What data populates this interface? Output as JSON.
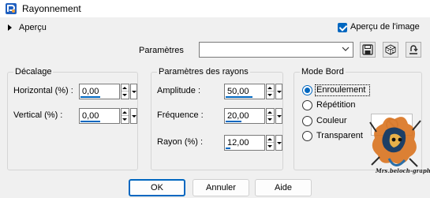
{
  "window": {
    "title": "Rayonnement",
    "app_icon": "psp-logo-icon"
  },
  "preview_toggle": {
    "label": "Aperçu"
  },
  "image_preview": {
    "label": "Aperçu de l'image",
    "checked": true
  },
  "params": {
    "label": "Paramètres",
    "value": ""
  },
  "groups": {
    "decalage": {
      "title": "Décalage",
      "horizontal": {
        "label": "Horizontal (%) :",
        "value": "0,00"
      },
      "vertical": {
        "label": "Vertical (%) :",
        "value": "0,00"
      }
    },
    "rayons": {
      "title": "Paramètres des rayons",
      "amplitude": {
        "label": "Amplitude :",
        "value": "50,00"
      },
      "frequence": {
        "label": "Fréquence :",
        "value": "20,00"
      },
      "rayon": {
        "label": "Rayon (%) :",
        "value": "12,00"
      }
    },
    "mode": {
      "title": "Mode Bord",
      "options": [
        "Enroulement",
        "Répétition",
        "Couleur",
        "Transparent"
      ],
      "selected": "Enroulement"
    }
  },
  "buttons": {
    "ok": "OK",
    "cancel": "Annuler",
    "help": "Aide"
  },
  "watermark": {
    "text": "Mrs.beloch-graph"
  },
  "colors": {
    "accent": "#0067c0",
    "bg": "#f0f0f0"
  }
}
